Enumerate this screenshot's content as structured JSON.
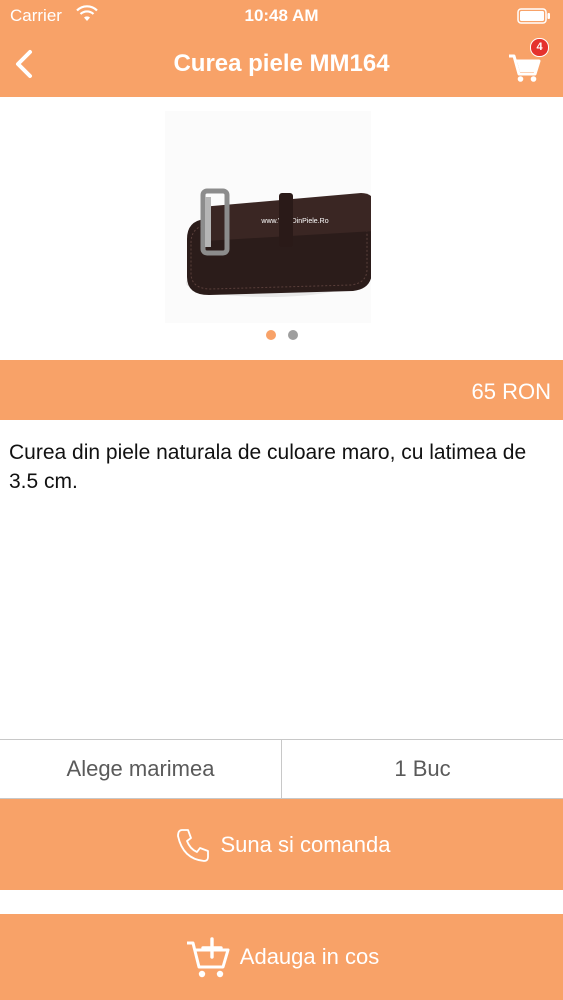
{
  "status_bar": {
    "carrier": "Carrier",
    "time": "10:48 AM",
    "wifi_icon": "wifi-icon",
    "battery_icon": "battery-icon"
  },
  "nav": {
    "title": "Curea piele MM164",
    "back_icon": "chevron-left-icon",
    "cart_icon": "shopping-cart-icon",
    "cart_count": "4"
  },
  "product": {
    "image_watermark": "www.VisaDinPiele.Ro",
    "carousel_total": 2,
    "carousel_active": 1,
    "price": "65 RON",
    "description": "Curea din piele naturala de culoare maro, cu latimea de 3.5 cm."
  },
  "selectors": {
    "size_label": "Alege marimea",
    "quantity_label": "1 Buc"
  },
  "actions": {
    "call_label": "Suna si comanda",
    "call_icon": "phone-icon",
    "add_label": "Adauga in cos",
    "add_icon": "cart-add-icon"
  },
  "colors": {
    "accent": "#f8a268",
    "badge": "#e5322d",
    "dot_active": "#f8a268",
    "dot_inactive": "#9e9e9e"
  }
}
